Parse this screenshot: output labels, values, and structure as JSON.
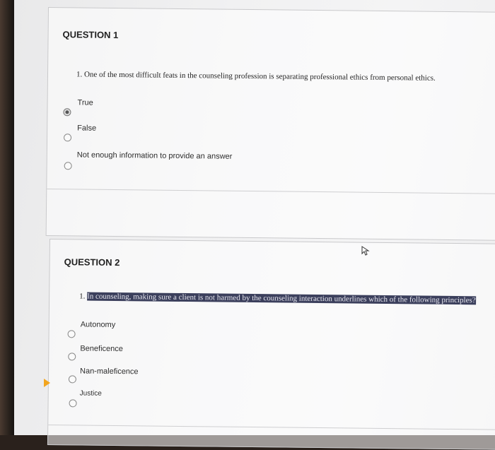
{
  "questions": [
    {
      "title": "QUESTION 1",
      "text": "1. One of the most difficult feats in the counseling profession is separating professional ethics from personal ethics.",
      "options": [
        {
          "label": "True",
          "selected": true
        },
        {
          "label": "False",
          "selected": false
        },
        {
          "label": "Not enough information to provide an answer",
          "selected": false
        }
      ]
    },
    {
      "title": "QUESTION 2",
      "text_number": "1.",
      "text_highlighted": "In counseling, making sure a client is not harmed by the counseling interaction underlines which of the following principles?",
      "options": [
        {
          "label": "Autonomy",
          "selected": false
        },
        {
          "label": "Beneficence",
          "selected": false
        },
        {
          "label": "Nan-maleficence",
          "selected": false
        },
        {
          "label": "Justice",
          "selected": false
        }
      ]
    }
  ]
}
